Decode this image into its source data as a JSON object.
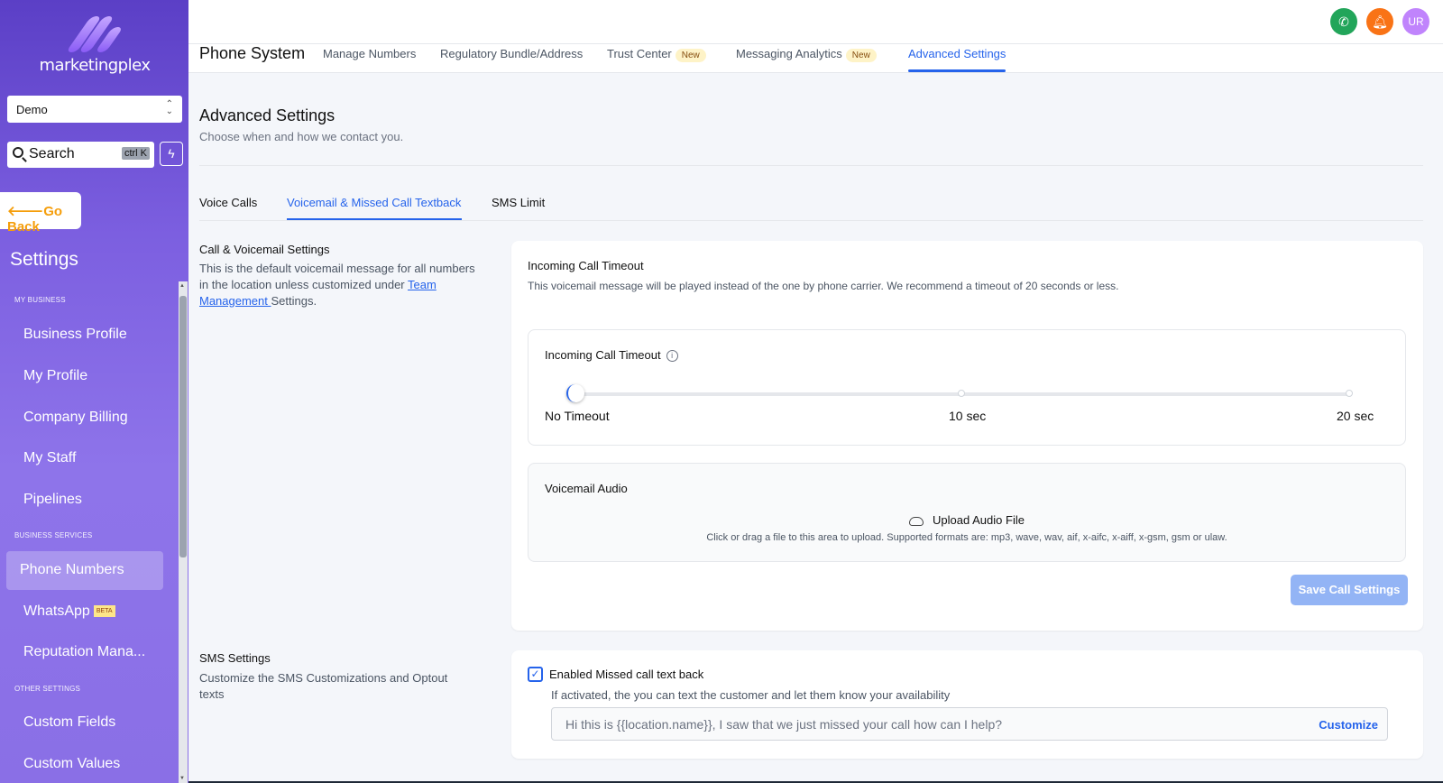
{
  "sidebar": {
    "logo_text": "marketingplex",
    "location": "Demo",
    "search_placeholder": "Search",
    "search_shortcut": "ctrl K",
    "go_back": "Go Back",
    "title": "Settings",
    "sections": {
      "my_business": "MY BUSINESS",
      "business_services": "BUSINESS SERVICES",
      "other_settings": "OTHER SETTINGS"
    },
    "items": {
      "business_profile": "Business Profile",
      "my_profile": "My Profile",
      "company_billing": "Company Billing",
      "my_staff": "My Staff",
      "pipelines": "Pipelines",
      "phone_numbers": "Phone Numbers",
      "whatsapp": "WhatsApp",
      "whatsapp_badge": "BETA",
      "reputation": "Reputation Mana...",
      "custom_fields": "Custom Fields",
      "custom_values": "Custom Values"
    }
  },
  "topbar": {
    "avatar_initials": "UR",
    "phone_color": "#22a55a",
    "bell_color": "#f97316",
    "avatar_color": "#c084fc"
  },
  "subnav": {
    "title": "Phone System",
    "tabs": {
      "manage_numbers": "Manage Numbers",
      "regulatory": "Regulatory Bundle/Address",
      "trust_center": "Trust Center",
      "messaging_analytics": "Messaging Analytics",
      "advanced_settings": "Advanced Settings"
    },
    "new_badge": "New"
  },
  "page": {
    "title": "Advanced Settings",
    "subtitle": "Choose when and how we contact you."
  },
  "tabs": {
    "voice_calls": "Voice Calls",
    "voicemail": "Voicemail & Missed Call Textback",
    "sms_limit": "SMS Limit"
  },
  "call_section": {
    "heading": "Call & Voicemail Settings",
    "desc_before": "This is the default voicemail message for all numbers in the location unless customized under ",
    "link": "Team Management ",
    "desc_after": "Settings."
  },
  "timeout_card": {
    "title": "Incoming Call Timeout",
    "desc": "This voicemail message will be played instead of the one by phone carrier. We recommend a timeout of 20 seconds or less.",
    "slider_label": "Incoming Call Timeout",
    "slider_value": 0,
    "ticks": [
      "No Timeout",
      "10 sec",
      "20 sec"
    ]
  },
  "voicemail_audio": {
    "title": "Voicemail Audio",
    "upload": "Upload Audio File",
    "hint": "Click or drag a file to this area to upload. Supported formats are: mp3, wave, wav, aif, x-aifc, x-aiff, x-gsm, gsm or ulaw."
  },
  "save_button": "Save Call Settings",
  "sms_section": {
    "heading": "SMS Settings",
    "desc": "Customize the SMS Customizations and Optout texts",
    "checkbox_label": "Enabled Missed call text back",
    "checkbox_checked": true,
    "checkbox_desc": "If activated, the you can text the customer and let them know your availability",
    "message": "Hi this is {{location.name}}, I saw that we just missed your call how can I help?",
    "customize": "Customize"
  }
}
